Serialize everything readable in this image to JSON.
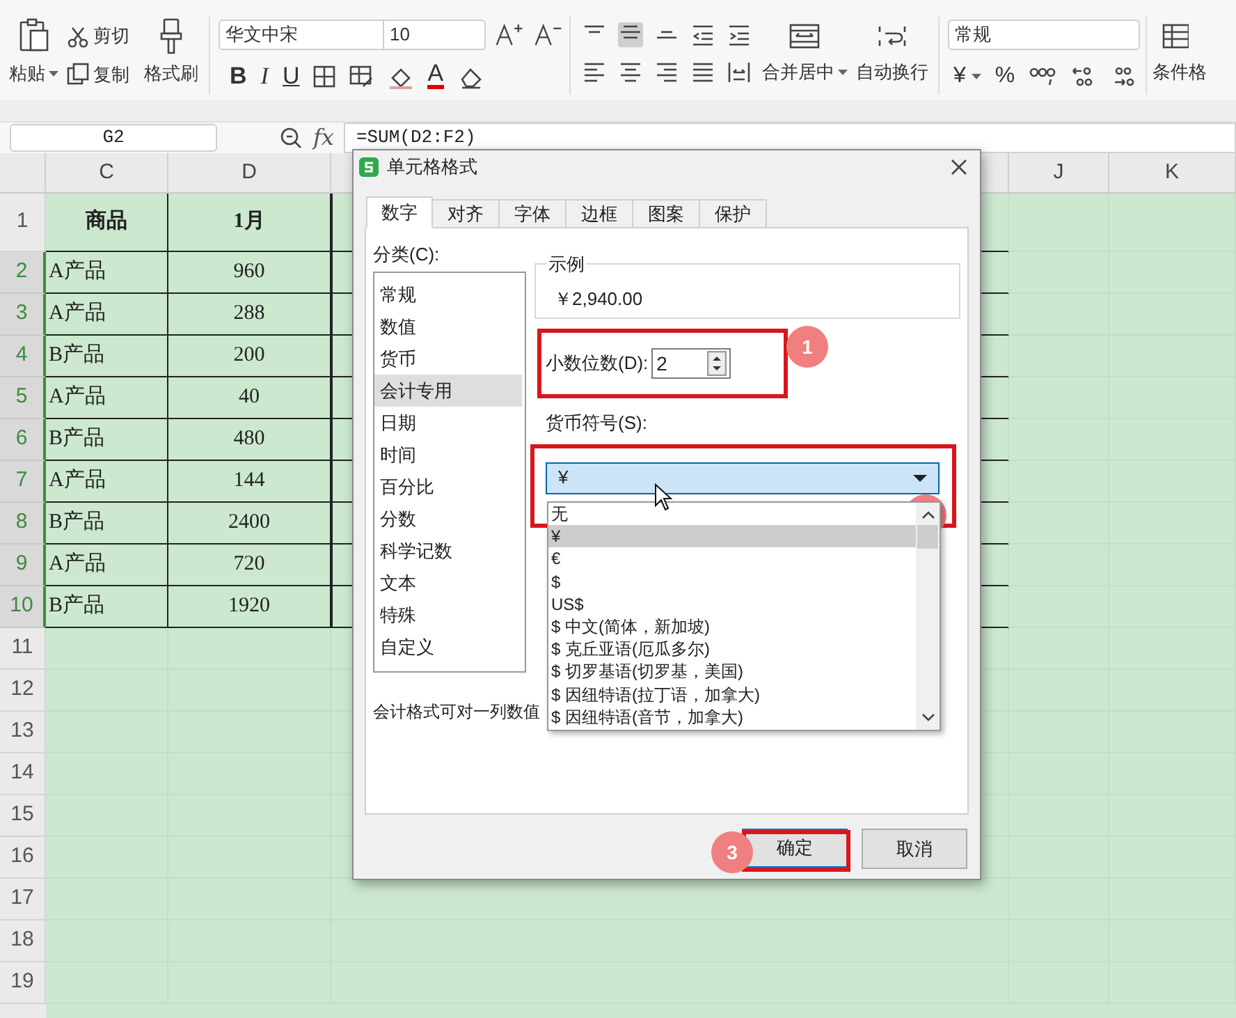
{
  "ribbon": {
    "clipboard": {
      "paste": "粘贴",
      "cut": "剪切",
      "copy": "复制",
      "format_painter": "格式刷"
    },
    "font": {
      "name": "华文中宋",
      "size": "10",
      "bold": "B",
      "italic": "I",
      "underline": "U",
      "font_color": "A"
    },
    "alignment": {
      "merge": "合并居中",
      "wrap": "自动换行"
    },
    "number": {
      "format": "常规",
      "currency": "¥",
      "percent": "%"
    },
    "conditional_format": "条件格"
  },
  "formula_bar": {
    "name_box": "G2",
    "fx": "fx",
    "formula": "=SUM(D2:F2)"
  },
  "columns": [
    {
      "label": "C"
    },
    {
      "label": "D"
    },
    {
      "label": "J"
    },
    {
      "label": "K"
    }
  ],
  "rows": [
    {
      "number": "1",
      "kind": "header",
      "highlighted": false,
      "cells": [
        "商品",
        "1月"
      ]
    },
    {
      "number": "2",
      "kind": "data",
      "highlighted": true,
      "cells": [
        "A产品",
        "960"
      ]
    },
    {
      "number": "3",
      "kind": "data",
      "highlighted": true,
      "cells": [
        "A产品",
        "288"
      ]
    },
    {
      "number": "4",
      "kind": "data",
      "highlighted": true,
      "cells": [
        "B产品",
        "200"
      ]
    },
    {
      "number": "5",
      "kind": "data",
      "highlighted": true,
      "cells": [
        "A产品",
        "40"
      ]
    },
    {
      "number": "6",
      "kind": "data",
      "highlighted": true,
      "cells": [
        "B产品",
        "480"
      ]
    },
    {
      "number": "7",
      "kind": "data",
      "highlighted": true,
      "cells": [
        "A产品",
        "144"
      ]
    },
    {
      "number": "8",
      "kind": "data",
      "highlighted": true,
      "cells": [
        "B产品",
        "2400"
      ]
    },
    {
      "number": "9",
      "kind": "data",
      "highlighted": true,
      "cells": [
        "A产品",
        "720"
      ]
    },
    {
      "number": "10",
      "kind": "data",
      "highlighted": true,
      "cells": [
        "B产品",
        "1920"
      ]
    },
    {
      "number": "11",
      "kind": "empty",
      "highlighted": false
    },
    {
      "number": "12",
      "kind": "empty",
      "highlighted": false
    },
    {
      "number": "13",
      "kind": "empty",
      "highlighted": false
    },
    {
      "number": "14",
      "kind": "empty",
      "highlighted": false
    },
    {
      "number": "15",
      "kind": "empty",
      "highlighted": false
    },
    {
      "number": "16",
      "kind": "empty",
      "highlighted": false
    },
    {
      "number": "17",
      "kind": "empty",
      "highlighted": false
    },
    {
      "number": "18",
      "kind": "empty",
      "highlighted": false
    },
    {
      "number": "19",
      "kind": "empty",
      "highlighted": false
    }
  ],
  "dialog": {
    "title": "单元格格式",
    "tabs": [
      {
        "label": "数字",
        "selected": true
      },
      {
        "label": "对齐",
        "selected": false
      },
      {
        "label": "字体",
        "selected": false
      },
      {
        "label": "边框",
        "selected": false
      },
      {
        "label": "图案",
        "selected": false
      },
      {
        "label": "保护",
        "selected": false
      }
    ],
    "category_label": "分类(C):",
    "categories": [
      {
        "label": "常规",
        "selected": false
      },
      {
        "label": "数值",
        "selected": false
      },
      {
        "label": "货币",
        "selected": false
      },
      {
        "label": "会计专用",
        "selected": true
      },
      {
        "label": "日期",
        "selected": false
      },
      {
        "label": "时间",
        "selected": false
      },
      {
        "label": "百分比",
        "selected": false
      },
      {
        "label": "分数",
        "selected": false
      },
      {
        "label": "科学记数",
        "selected": false
      },
      {
        "label": "文本",
        "selected": false
      },
      {
        "label": "特殊",
        "selected": false
      },
      {
        "label": "自定义",
        "selected": false
      }
    ],
    "sample_label": "示例",
    "sample_value": "￥2,940.00",
    "decimals_label": "小数位数(D):",
    "decimals_value": "2",
    "currency_label": "货币符号(S):",
    "currency_value": "¥",
    "currency_options": [
      {
        "label": "无",
        "selected": false
      },
      {
        "label": "¥",
        "selected": true
      },
      {
        "label": "€",
        "selected": false
      },
      {
        "label": "$",
        "selected": false
      },
      {
        "label": "US$",
        "selected": false
      },
      {
        "label": "$ 中文(简体，新加坡)",
        "selected": false
      },
      {
        "label": "$ 克丘亚语(厄瓜多尔)",
        "selected": false
      },
      {
        "label": "$ 切罗基语(切罗基，美国)",
        "selected": false
      },
      {
        "label": "$ 因纽特语(拉丁语，加拿大)",
        "selected": false
      },
      {
        "label": "$ 因纽特语(音节，加拿大)",
        "selected": false
      }
    ],
    "description": "会计格式可对一列数值",
    "buttons": [
      {
        "label": "确定",
        "kind": "primary"
      },
      {
        "label": "取消",
        "kind": "default"
      }
    ],
    "callouts": [
      "1",
      "3"
    ]
  }
}
